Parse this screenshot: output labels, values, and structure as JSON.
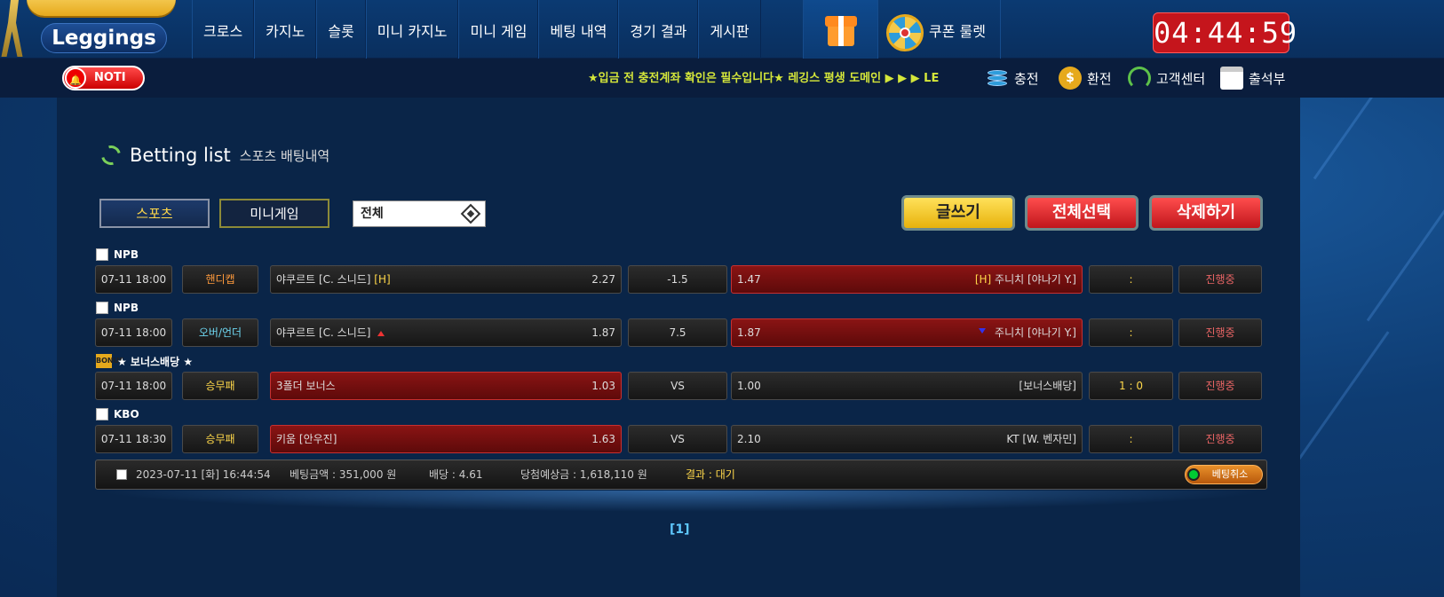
{
  "brand": {
    "logo_text": "Leggings"
  },
  "nav": {
    "items": [
      "크로스",
      "카지노",
      "슬롯",
      "미니 카지노",
      "미니 게임",
      "베팅 내역",
      "경기 결과",
      "게시판"
    ],
    "gift_icon": "gift-icon",
    "coupon_label": "쿠폰 룰렛"
  },
  "clock": "04:44:59",
  "subbar": {
    "noti_label": "NOTI",
    "marquee": "★입금 전 충전계좌 확인은 필수입니다★ 레깅스 평생 도메인 ▶ ▶ ▶ LE",
    "quick": [
      {
        "label": "충전",
        "icon": "coins-icon"
      },
      {
        "label": "환전",
        "icon": "exchange-icon"
      },
      {
        "label": "고객센터",
        "icon": "headset-icon"
      },
      {
        "label": "출석부",
        "icon": "calendar-icon"
      }
    ]
  },
  "page": {
    "title": "Betting list",
    "subtitle": "스포츠 배팅내역",
    "tabs": {
      "sports": "스포츠",
      "mini": "미니게임"
    },
    "filter_value": "전체",
    "buttons": {
      "write": "글쓰기",
      "select_all": "전체선택",
      "delete": "삭제하기"
    }
  },
  "bets": [
    {
      "league": "NPB",
      "date": "07-11 18:00",
      "type": "핸디캡",
      "home": "야쿠르트 [C. 스니드]",
      "home_tag": "[H]",
      "home_odds": "2.27",
      "mid": "-1.5",
      "away_odds": "1.47",
      "away_tag": "[H]",
      "away": "주니치 [야나기 Y.]",
      "score": ":",
      "status": "진행중"
    },
    {
      "league": "NPB",
      "date": "07-11 18:00",
      "type": "오버/언더",
      "home": "야쿠르트 [C. 스니드]",
      "home_tag": "",
      "home_odds": "1.87",
      "mid": "7.5",
      "away_odds": "1.87",
      "away_tag": "",
      "away": "주니치 [야나기 Y.]",
      "score": ":",
      "status": "진행중"
    },
    {
      "league": "★ 보너스배당 ★",
      "date": "07-11 18:00",
      "type": "승무패",
      "home": "3폴더 보너스",
      "home_tag": "",
      "home_odds": "1.03",
      "mid": "VS",
      "away_odds": "1.00",
      "away_tag": "",
      "away": "[보너스배당]",
      "score": "1 : 0",
      "status": "진행중"
    },
    {
      "league": "KBO",
      "date": "07-11 18:30",
      "type": "승무패",
      "home": "키움 [안우진]",
      "home_tag": "",
      "home_odds": "1.63",
      "mid": "VS",
      "away_odds": "2.10",
      "away_tag": "",
      "away": "KT [W. 벤자민]",
      "score": ":",
      "status": "진행중"
    }
  ],
  "summary": {
    "datetime": "2023-07-11 [화] 16:44:54",
    "amount": "베팅금액 : 351,000 원",
    "odds": "배당 : 4.61",
    "expected": "당첨예상금 : 1,618,110 원",
    "result": "결과 : 대기",
    "cancel_label": "베팅취소"
  },
  "pagination": "[1]"
}
